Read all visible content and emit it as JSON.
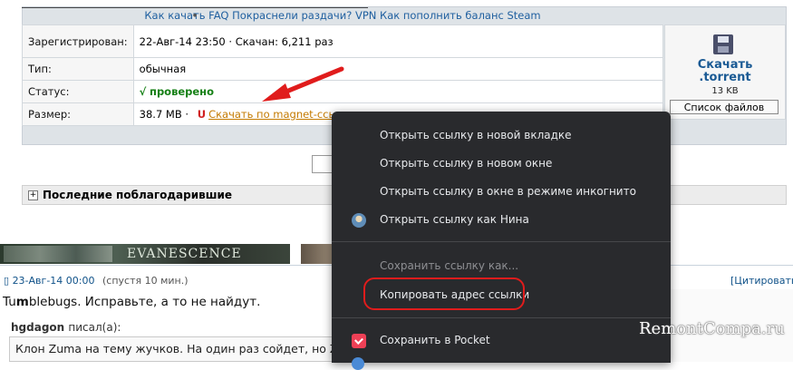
{
  "topnav": {
    "links": [
      "Как качать",
      "FAQ",
      "Покраснели раздачи?",
      "VPN",
      "Как пополнить баланс Steam"
    ]
  },
  "info": {
    "registered_label": "Зарегистрирован:",
    "registered_value": "22-Авг-14 23:50",
    "downloads_text": "Скачан: 6,211 раз",
    "type_label": "Тип:",
    "type_value": "обычная",
    "status_label": "Статус:",
    "status_check": "√",
    "status_value": "проверено",
    "size_label": "Размер:",
    "size_value": "38.7 MB",
    "magnet_symbol": "U",
    "magnet_link": "Скачать по magnet-ссылке"
  },
  "download": {
    "title_line1": "Скачать",
    "title_line2": ".torrent",
    "size": "13 KB",
    "file_list_button": "Список файлов"
  },
  "thanks": {
    "label": "Последние поблагодарившие",
    "toggle": "+"
  },
  "banner": {
    "text": "EVANESCENCE"
  },
  "post": {
    "date": "23-Авг-14 00:00",
    "after": "(спустя 10 мин.)",
    "quote_button": "[Цитировать",
    "text_pre": "Tu",
    "text_bold": "m",
    "text_post": "blebugs. Исправьте, а то не найдут.",
    "quote_author": "hgdagon",
    "quote_wrote": "писал(а):",
    "quote_text": "Клон Zuma на тему жучков. На один раз сойдет, но Zu"
  },
  "context_menu": {
    "items": [
      "Открыть ссылку в новой вкладке",
      "Открыть ссылку в новом окне",
      "Открыть ссылку в окне в режиме инкогнито",
      "Открыть ссылку как Нина",
      "Сохранить ссылку как...",
      "Копировать адрес ссылки",
      "Сохранить в Pocket"
    ]
  },
  "watermark": "RemontCompa.ru",
  "colors": {
    "menu_bg": "#292a2d",
    "highlight_oval": "#e01c1c",
    "link_blue": "#105289",
    "magnet_orange": "#c47a00"
  }
}
